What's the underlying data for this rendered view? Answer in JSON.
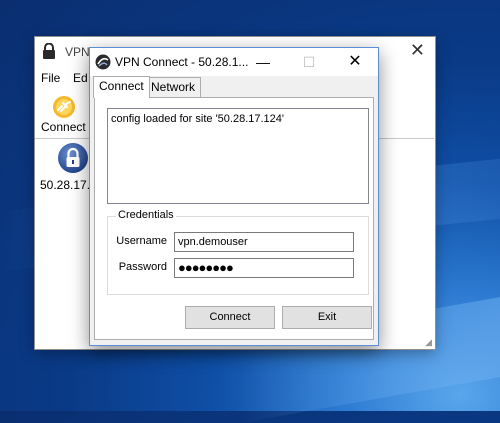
{
  "background_window": {
    "title": "VPN",
    "close_glyph": "✕",
    "menu": [
      "File",
      "Ed"
    ],
    "toolbar": {
      "connect_label": "Connect",
      "icon": "connect-icon"
    },
    "site_list": [
      {
        "label": "50.28.17.1",
        "icon": "lock-icon"
      }
    ]
  },
  "dialog": {
    "title": "VPN Connect - 50.28.1...",
    "controls": {
      "minimize": "—",
      "maximize": "☐",
      "close": "✕"
    },
    "tabs": [
      {
        "label": "Connect",
        "active": true
      },
      {
        "label": "Network",
        "active": false
      }
    ],
    "log_text": "config loaded for site '50.28.17.124'",
    "credentials": {
      "legend": "Credentials",
      "username_label": "Username",
      "username_value": "vpn.demouser",
      "password_label": "Password",
      "password_value": "●●●●●●●●"
    },
    "buttons": {
      "connect": "Connect",
      "exit": "Exit"
    }
  },
  "colors": {
    "desktop": "#0f4fa6",
    "dialog_border": "#5b8ed6",
    "accent": "#f5b82e"
  }
}
